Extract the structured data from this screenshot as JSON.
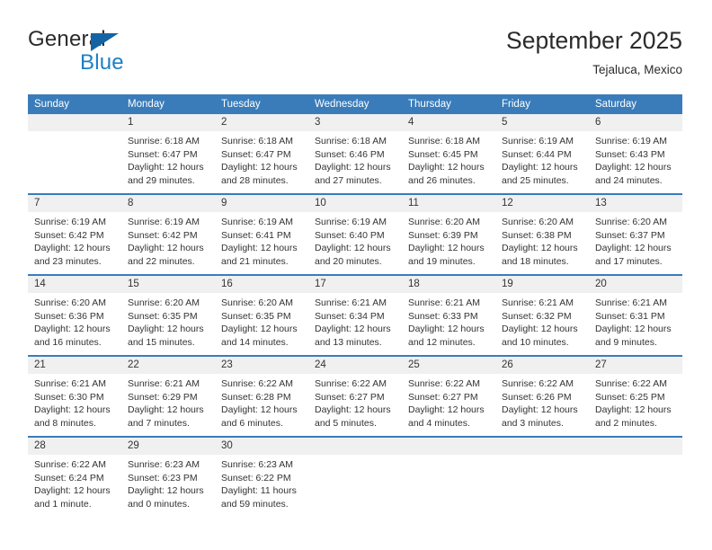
{
  "brand": {
    "name_top": "General",
    "name_bottom": "Blue",
    "triangle_color": "#1464a5",
    "blue_color": "#1e7fc4"
  },
  "header": {
    "title": "September 2025",
    "subtitle": "Tejaluca, Mexico"
  },
  "theme": {
    "header_bg": "#3a7cba",
    "header_text": "#ffffff",
    "daynum_bg": "#f0f0f0",
    "cell_bg": "#ffffff",
    "text": "#333333"
  },
  "weekday_headers": [
    "Sunday",
    "Monday",
    "Tuesday",
    "Wednesday",
    "Thursday",
    "Friday",
    "Saturday"
  ],
  "weeks": [
    [
      {
        "day": "",
        "sunrise": "",
        "sunset": "",
        "daylight_line1": "",
        "daylight_line2": ""
      },
      {
        "day": "1",
        "sunrise": "Sunrise: 6:18 AM",
        "sunset": "Sunset: 6:47 PM",
        "daylight_line1": "Daylight: 12 hours",
        "daylight_line2": "and 29 minutes."
      },
      {
        "day": "2",
        "sunrise": "Sunrise: 6:18 AM",
        "sunset": "Sunset: 6:47 PM",
        "daylight_line1": "Daylight: 12 hours",
        "daylight_line2": "and 28 minutes."
      },
      {
        "day": "3",
        "sunrise": "Sunrise: 6:18 AM",
        "sunset": "Sunset: 6:46 PM",
        "daylight_line1": "Daylight: 12 hours",
        "daylight_line2": "and 27 minutes."
      },
      {
        "day": "4",
        "sunrise": "Sunrise: 6:18 AM",
        "sunset": "Sunset: 6:45 PM",
        "daylight_line1": "Daylight: 12 hours",
        "daylight_line2": "and 26 minutes."
      },
      {
        "day": "5",
        "sunrise": "Sunrise: 6:19 AM",
        "sunset": "Sunset: 6:44 PM",
        "daylight_line1": "Daylight: 12 hours",
        "daylight_line2": "and 25 minutes."
      },
      {
        "day": "6",
        "sunrise": "Sunrise: 6:19 AM",
        "sunset": "Sunset: 6:43 PM",
        "daylight_line1": "Daylight: 12 hours",
        "daylight_line2": "and 24 minutes."
      }
    ],
    [
      {
        "day": "7",
        "sunrise": "Sunrise: 6:19 AM",
        "sunset": "Sunset: 6:42 PM",
        "daylight_line1": "Daylight: 12 hours",
        "daylight_line2": "and 23 minutes."
      },
      {
        "day": "8",
        "sunrise": "Sunrise: 6:19 AM",
        "sunset": "Sunset: 6:42 PM",
        "daylight_line1": "Daylight: 12 hours",
        "daylight_line2": "and 22 minutes."
      },
      {
        "day": "9",
        "sunrise": "Sunrise: 6:19 AM",
        "sunset": "Sunset: 6:41 PM",
        "daylight_line1": "Daylight: 12 hours",
        "daylight_line2": "and 21 minutes."
      },
      {
        "day": "10",
        "sunrise": "Sunrise: 6:19 AM",
        "sunset": "Sunset: 6:40 PM",
        "daylight_line1": "Daylight: 12 hours",
        "daylight_line2": "and 20 minutes."
      },
      {
        "day": "11",
        "sunrise": "Sunrise: 6:20 AM",
        "sunset": "Sunset: 6:39 PM",
        "daylight_line1": "Daylight: 12 hours",
        "daylight_line2": "and 19 minutes."
      },
      {
        "day": "12",
        "sunrise": "Sunrise: 6:20 AM",
        "sunset": "Sunset: 6:38 PM",
        "daylight_line1": "Daylight: 12 hours",
        "daylight_line2": "and 18 minutes."
      },
      {
        "day": "13",
        "sunrise": "Sunrise: 6:20 AM",
        "sunset": "Sunset: 6:37 PM",
        "daylight_line1": "Daylight: 12 hours",
        "daylight_line2": "and 17 minutes."
      }
    ],
    [
      {
        "day": "14",
        "sunrise": "Sunrise: 6:20 AM",
        "sunset": "Sunset: 6:36 PM",
        "daylight_line1": "Daylight: 12 hours",
        "daylight_line2": "and 16 minutes."
      },
      {
        "day": "15",
        "sunrise": "Sunrise: 6:20 AM",
        "sunset": "Sunset: 6:35 PM",
        "daylight_line1": "Daylight: 12 hours",
        "daylight_line2": "and 15 minutes."
      },
      {
        "day": "16",
        "sunrise": "Sunrise: 6:20 AM",
        "sunset": "Sunset: 6:35 PM",
        "daylight_line1": "Daylight: 12 hours",
        "daylight_line2": "and 14 minutes."
      },
      {
        "day": "17",
        "sunrise": "Sunrise: 6:21 AM",
        "sunset": "Sunset: 6:34 PM",
        "daylight_line1": "Daylight: 12 hours",
        "daylight_line2": "and 13 minutes."
      },
      {
        "day": "18",
        "sunrise": "Sunrise: 6:21 AM",
        "sunset": "Sunset: 6:33 PM",
        "daylight_line1": "Daylight: 12 hours",
        "daylight_line2": "and 12 minutes."
      },
      {
        "day": "19",
        "sunrise": "Sunrise: 6:21 AM",
        "sunset": "Sunset: 6:32 PM",
        "daylight_line1": "Daylight: 12 hours",
        "daylight_line2": "and 10 minutes."
      },
      {
        "day": "20",
        "sunrise": "Sunrise: 6:21 AM",
        "sunset": "Sunset: 6:31 PM",
        "daylight_line1": "Daylight: 12 hours",
        "daylight_line2": "and 9 minutes."
      }
    ],
    [
      {
        "day": "21",
        "sunrise": "Sunrise: 6:21 AM",
        "sunset": "Sunset: 6:30 PM",
        "daylight_line1": "Daylight: 12 hours",
        "daylight_line2": "and 8 minutes."
      },
      {
        "day": "22",
        "sunrise": "Sunrise: 6:21 AM",
        "sunset": "Sunset: 6:29 PM",
        "daylight_line1": "Daylight: 12 hours",
        "daylight_line2": "and 7 minutes."
      },
      {
        "day": "23",
        "sunrise": "Sunrise: 6:22 AM",
        "sunset": "Sunset: 6:28 PM",
        "daylight_line1": "Daylight: 12 hours",
        "daylight_line2": "and 6 minutes."
      },
      {
        "day": "24",
        "sunrise": "Sunrise: 6:22 AM",
        "sunset": "Sunset: 6:27 PM",
        "daylight_line1": "Daylight: 12 hours",
        "daylight_line2": "and 5 minutes."
      },
      {
        "day": "25",
        "sunrise": "Sunrise: 6:22 AM",
        "sunset": "Sunset: 6:27 PM",
        "daylight_line1": "Daylight: 12 hours",
        "daylight_line2": "and 4 minutes."
      },
      {
        "day": "26",
        "sunrise": "Sunrise: 6:22 AM",
        "sunset": "Sunset: 6:26 PM",
        "daylight_line1": "Daylight: 12 hours",
        "daylight_line2": "and 3 minutes."
      },
      {
        "day": "27",
        "sunrise": "Sunrise: 6:22 AM",
        "sunset": "Sunset: 6:25 PM",
        "daylight_line1": "Daylight: 12 hours",
        "daylight_line2": "and 2 minutes."
      }
    ],
    [
      {
        "day": "28",
        "sunrise": "Sunrise: 6:22 AM",
        "sunset": "Sunset: 6:24 PM",
        "daylight_line1": "Daylight: 12 hours",
        "daylight_line2": "and 1 minute."
      },
      {
        "day": "29",
        "sunrise": "Sunrise: 6:23 AM",
        "sunset": "Sunset: 6:23 PM",
        "daylight_line1": "Daylight: 12 hours",
        "daylight_line2": "and 0 minutes."
      },
      {
        "day": "30",
        "sunrise": "Sunrise: 6:23 AM",
        "sunset": "Sunset: 6:22 PM",
        "daylight_line1": "Daylight: 11 hours",
        "daylight_line2": "and 59 minutes."
      },
      {
        "day": "",
        "sunrise": "",
        "sunset": "",
        "daylight_line1": "",
        "daylight_line2": ""
      },
      {
        "day": "",
        "sunrise": "",
        "sunset": "",
        "daylight_line1": "",
        "daylight_line2": ""
      },
      {
        "day": "",
        "sunrise": "",
        "sunset": "",
        "daylight_line1": "",
        "daylight_line2": ""
      },
      {
        "day": "",
        "sunrise": "",
        "sunset": "",
        "daylight_line1": "",
        "daylight_line2": ""
      }
    ]
  ]
}
